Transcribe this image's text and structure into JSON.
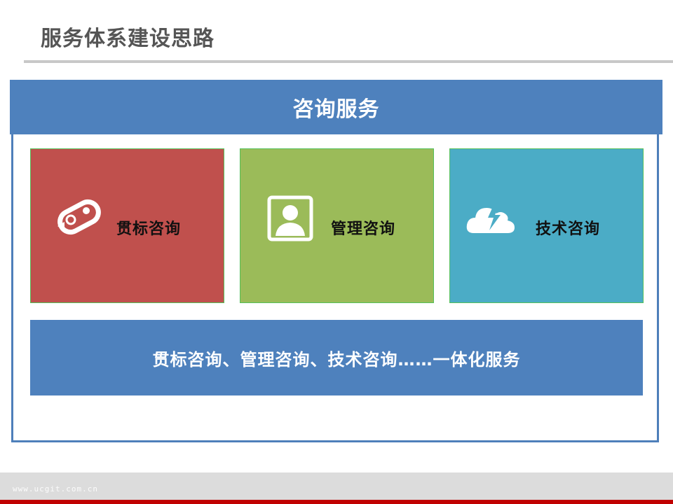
{
  "title": "服务体系建设思路",
  "header": {
    "label": "咨询服务"
  },
  "cards": [
    {
      "label": "贯标咨询",
      "icon": "refresh-link-icon",
      "color": "#c0504d"
    },
    {
      "label": "管理咨询",
      "icon": "person-portrait-icon",
      "color": "#9bbb59"
    },
    {
      "label": "技术咨询",
      "icon": "cloud-lightning-icon",
      "color": "#4bacc6"
    }
  ],
  "summary": {
    "label": "贯标咨询、管理咨询、技术咨询……一体化服务"
  },
  "footer": {
    "url": "www.ucgit.com.cn"
  },
  "colors": {
    "accent_blue": "#4e81bd",
    "footer_red": "#c00000"
  }
}
